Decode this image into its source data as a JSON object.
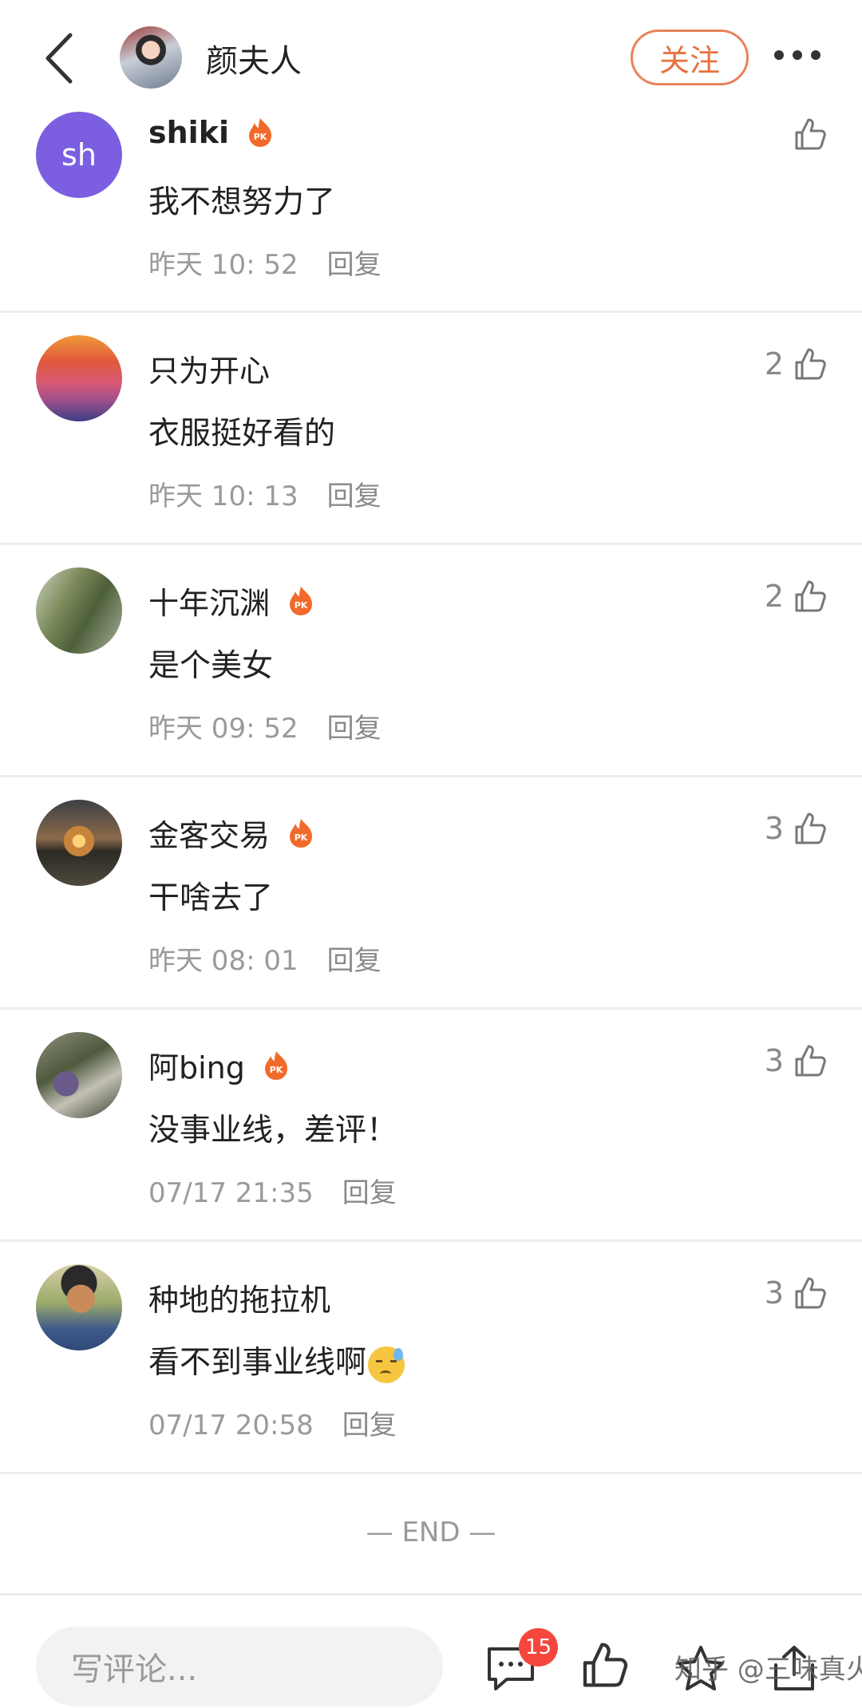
{
  "header": {
    "name": "颜夫人",
    "follow_label": "关注"
  },
  "comments": [
    {
      "name": "shiki",
      "pk": true,
      "text": "我不想努力了",
      "time": "昨天 10: 52",
      "reply": "回复",
      "likes": ""
    },
    {
      "name": "只为开心",
      "pk": false,
      "text": "衣服挺好看的",
      "time": "昨天 10: 13",
      "reply": "回复",
      "likes": "2"
    },
    {
      "name": "十年沉渊",
      "pk": true,
      "text": "是个美女",
      "time": "昨天 09: 52",
      "reply": "回复",
      "likes": "2"
    },
    {
      "name": "金客交易",
      "pk": true,
      "text": "干啥去了",
      "time": "昨天 08: 01",
      "reply": "回复",
      "likes": "3"
    },
    {
      "name": "阿bing",
      "pk": true,
      "text": "没事业线，差评！",
      "time": "07/17 21:35",
      "reply": "回复",
      "likes": "3"
    },
    {
      "name": "种地的拖拉机",
      "pk": false,
      "text": "看不到事业线啊",
      "time": "07/17 20:58",
      "reply": "回复",
      "likes": "3"
    }
  ],
  "avatar_initials": "sh",
  "end_text": "— END —",
  "bottom": {
    "input_placeholder": "写评论...",
    "comment_count": "15",
    "watermark": "知乎 @三味真火"
  },
  "colors": {
    "accent": "#e8723f",
    "badge": "#f5473d",
    "avatar_shiki": "#7b5fe0"
  },
  "icons": [
    "back-arrow-icon",
    "more-dots-icon",
    "pk-flame-icon",
    "thumbs-up-icon",
    "comment-icon",
    "share-icon",
    "sad-sweat-emoji"
  ]
}
